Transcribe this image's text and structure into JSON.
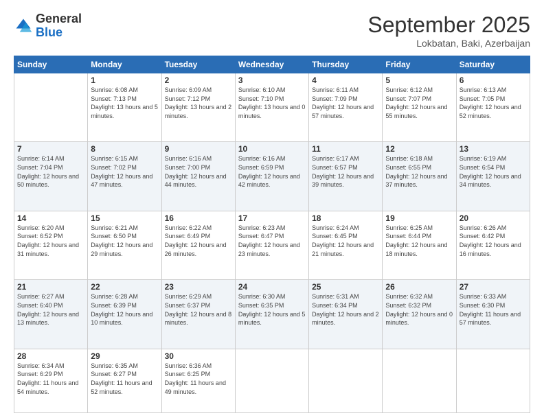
{
  "logo": {
    "general": "General",
    "blue": "Blue"
  },
  "header": {
    "month": "September 2025",
    "location": "Lokbatan, Baki, Azerbaijan"
  },
  "weekdays": [
    "Sunday",
    "Monday",
    "Tuesday",
    "Wednesday",
    "Thursday",
    "Friday",
    "Saturday"
  ],
  "weeks": [
    [
      {
        "day": "",
        "sunrise": "",
        "sunset": "",
        "daylight": ""
      },
      {
        "day": "1",
        "sunrise": "Sunrise: 6:08 AM",
        "sunset": "Sunset: 7:13 PM",
        "daylight": "Daylight: 13 hours and 5 minutes."
      },
      {
        "day": "2",
        "sunrise": "Sunrise: 6:09 AM",
        "sunset": "Sunset: 7:12 PM",
        "daylight": "Daylight: 13 hours and 2 minutes."
      },
      {
        "day": "3",
        "sunrise": "Sunrise: 6:10 AM",
        "sunset": "Sunset: 7:10 PM",
        "daylight": "Daylight: 13 hours and 0 minutes."
      },
      {
        "day": "4",
        "sunrise": "Sunrise: 6:11 AM",
        "sunset": "Sunset: 7:09 PM",
        "daylight": "Daylight: 12 hours and 57 minutes."
      },
      {
        "day": "5",
        "sunrise": "Sunrise: 6:12 AM",
        "sunset": "Sunset: 7:07 PM",
        "daylight": "Daylight: 12 hours and 55 minutes."
      },
      {
        "day": "6",
        "sunrise": "Sunrise: 6:13 AM",
        "sunset": "Sunset: 7:05 PM",
        "daylight": "Daylight: 12 hours and 52 minutes."
      }
    ],
    [
      {
        "day": "7",
        "sunrise": "Sunrise: 6:14 AM",
        "sunset": "Sunset: 7:04 PM",
        "daylight": "Daylight: 12 hours and 50 minutes."
      },
      {
        "day": "8",
        "sunrise": "Sunrise: 6:15 AM",
        "sunset": "Sunset: 7:02 PM",
        "daylight": "Daylight: 12 hours and 47 minutes."
      },
      {
        "day": "9",
        "sunrise": "Sunrise: 6:16 AM",
        "sunset": "Sunset: 7:00 PM",
        "daylight": "Daylight: 12 hours and 44 minutes."
      },
      {
        "day": "10",
        "sunrise": "Sunrise: 6:16 AM",
        "sunset": "Sunset: 6:59 PM",
        "daylight": "Daylight: 12 hours and 42 minutes."
      },
      {
        "day": "11",
        "sunrise": "Sunrise: 6:17 AM",
        "sunset": "Sunset: 6:57 PM",
        "daylight": "Daylight: 12 hours and 39 minutes."
      },
      {
        "day": "12",
        "sunrise": "Sunrise: 6:18 AM",
        "sunset": "Sunset: 6:55 PM",
        "daylight": "Daylight: 12 hours and 37 minutes."
      },
      {
        "day": "13",
        "sunrise": "Sunrise: 6:19 AM",
        "sunset": "Sunset: 6:54 PM",
        "daylight": "Daylight: 12 hours and 34 minutes."
      }
    ],
    [
      {
        "day": "14",
        "sunrise": "Sunrise: 6:20 AM",
        "sunset": "Sunset: 6:52 PM",
        "daylight": "Daylight: 12 hours and 31 minutes."
      },
      {
        "day": "15",
        "sunrise": "Sunrise: 6:21 AM",
        "sunset": "Sunset: 6:50 PM",
        "daylight": "Daylight: 12 hours and 29 minutes."
      },
      {
        "day": "16",
        "sunrise": "Sunrise: 6:22 AM",
        "sunset": "Sunset: 6:49 PM",
        "daylight": "Daylight: 12 hours and 26 minutes."
      },
      {
        "day": "17",
        "sunrise": "Sunrise: 6:23 AM",
        "sunset": "Sunset: 6:47 PM",
        "daylight": "Daylight: 12 hours and 23 minutes."
      },
      {
        "day": "18",
        "sunrise": "Sunrise: 6:24 AM",
        "sunset": "Sunset: 6:45 PM",
        "daylight": "Daylight: 12 hours and 21 minutes."
      },
      {
        "day": "19",
        "sunrise": "Sunrise: 6:25 AM",
        "sunset": "Sunset: 6:44 PM",
        "daylight": "Daylight: 12 hours and 18 minutes."
      },
      {
        "day": "20",
        "sunrise": "Sunrise: 6:26 AM",
        "sunset": "Sunset: 6:42 PM",
        "daylight": "Daylight: 12 hours and 16 minutes."
      }
    ],
    [
      {
        "day": "21",
        "sunrise": "Sunrise: 6:27 AM",
        "sunset": "Sunset: 6:40 PM",
        "daylight": "Daylight: 12 hours and 13 minutes."
      },
      {
        "day": "22",
        "sunrise": "Sunrise: 6:28 AM",
        "sunset": "Sunset: 6:39 PM",
        "daylight": "Daylight: 12 hours and 10 minutes."
      },
      {
        "day": "23",
        "sunrise": "Sunrise: 6:29 AM",
        "sunset": "Sunset: 6:37 PM",
        "daylight": "Daylight: 12 hours and 8 minutes."
      },
      {
        "day": "24",
        "sunrise": "Sunrise: 6:30 AM",
        "sunset": "Sunset: 6:35 PM",
        "daylight": "Daylight: 12 hours and 5 minutes."
      },
      {
        "day": "25",
        "sunrise": "Sunrise: 6:31 AM",
        "sunset": "Sunset: 6:34 PM",
        "daylight": "Daylight: 12 hours and 2 minutes."
      },
      {
        "day": "26",
        "sunrise": "Sunrise: 6:32 AM",
        "sunset": "Sunset: 6:32 PM",
        "daylight": "Daylight: 12 hours and 0 minutes."
      },
      {
        "day": "27",
        "sunrise": "Sunrise: 6:33 AM",
        "sunset": "Sunset: 6:30 PM",
        "daylight": "Daylight: 11 hours and 57 minutes."
      }
    ],
    [
      {
        "day": "28",
        "sunrise": "Sunrise: 6:34 AM",
        "sunset": "Sunset: 6:29 PM",
        "daylight": "Daylight: 11 hours and 54 minutes."
      },
      {
        "day": "29",
        "sunrise": "Sunrise: 6:35 AM",
        "sunset": "Sunset: 6:27 PM",
        "daylight": "Daylight: 11 hours and 52 minutes."
      },
      {
        "day": "30",
        "sunrise": "Sunrise: 6:36 AM",
        "sunset": "Sunset: 6:25 PM",
        "daylight": "Daylight: 11 hours and 49 minutes."
      },
      {
        "day": "",
        "sunrise": "",
        "sunset": "",
        "daylight": ""
      },
      {
        "day": "",
        "sunrise": "",
        "sunset": "",
        "daylight": ""
      },
      {
        "day": "",
        "sunrise": "",
        "sunset": "",
        "daylight": ""
      },
      {
        "day": "",
        "sunrise": "",
        "sunset": "",
        "daylight": ""
      }
    ]
  ]
}
